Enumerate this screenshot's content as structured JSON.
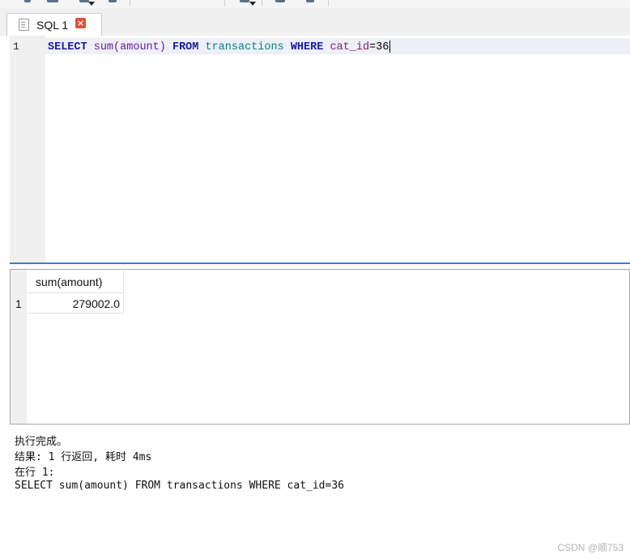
{
  "tabs": [
    {
      "label": "SQL 1",
      "close_icon": "close-icon"
    }
  ],
  "editor": {
    "line_number": "1",
    "tokens": {
      "select": "SELECT",
      "func": "sum",
      "paren_open": "(",
      "column": "amount",
      "paren_close": ")",
      "from": "FROM",
      "table": "transactions",
      "where": "WHERE",
      "cond_col": "cat_id",
      "cond_rest": "=36"
    }
  },
  "results": {
    "columns": [
      "sum(amount)"
    ],
    "rows": [
      {
        "num": "1",
        "cells": [
          "279002.0"
        ]
      }
    ]
  },
  "messages": [
    "执行完成。",
    "结果: 1 行返回, 耗时 4ms",
    "在行 1:",
    "SELECT sum(amount) FROM transactions WHERE cat_id=36"
  ],
  "watermark": "CSDN @顺753",
  "colors": {
    "keyword": "#1a1aa6",
    "function": "#6a1b9a",
    "table": "#00808a",
    "column": "#8b1a6a",
    "splitter": "#3a7ec4",
    "close_button": "#e0503a"
  }
}
